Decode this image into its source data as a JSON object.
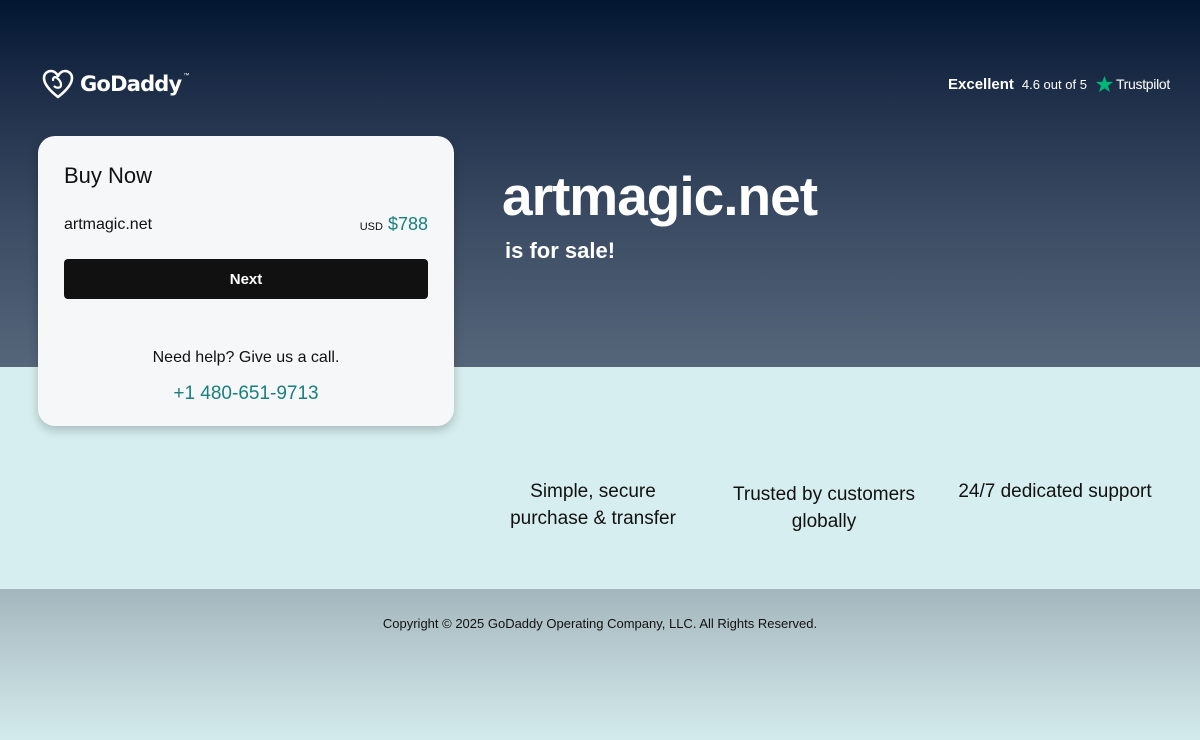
{
  "header": {
    "logo_text": "GoDaddy",
    "logo_tm": "™",
    "logo_icon": "godaddy-heart-icon",
    "trustpilot": {
      "rating_word": "Excellent",
      "score_text": "4.6 out of 5",
      "brand": "Trustpilot",
      "star_icon": "star-icon",
      "star_color": "#00b67a"
    }
  },
  "card": {
    "title": "Buy Now",
    "domain": "artmagic.net",
    "currency": "USD",
    "price": "$788",
    "next_label": "Next",
    "help_text": "Need help? Give us a call.",
    "phone": "+1 480-651-9713"
  },
  "hero": {
    "domain": "artmagic.net",
    "subtitle": "is for sale!"
  },
  "features": [
    {
      "line1": "Simple, secure",
      "line2": "purchase & transfer"
    },
    {
      "line1": "Trusted by customers",
      "line2": "globally"
    },
    {
      "line1": "24/7 dedicated support",
      "line2": ""
    }
  ],
  "footer": {
    "copyright": "Copyright © 2025 GoDaddy Operating Company, LLC. All Rights Reserved."
  },
  "colors": {
    "accent_teal": "#1a7f7f",
    "button_bg": "#111111",
    "hero_top": "#021631",
    "hero_bottom": "#56667a",
    "band_bg": "#d6eeef"
  }
}
